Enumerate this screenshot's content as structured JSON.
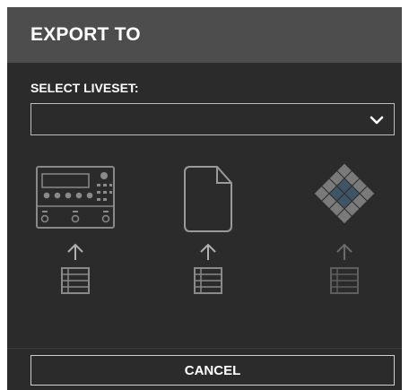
{
  "dialog": {
    "title": "EXPORT TO",
    "select_label": "SELECT LIVESET:",
    "liveset_select": {
      "value": ""
    },
    "targets": [
      {
        "icon": "hardware-unit-icon",
        "arrow_icon": "upload-arrow-icon",
        "list_icon": "setlist-icon",
        "enabled": true
      },
      {
        "icon": "file-icon",
        "arrow_icon": "upload-arrow-icon",
        "list_icon": "setlist-icon",
        "enabled": true
      },
      {
        "icon": "diamond-grid-icon",
        "arrow_icon": "upload-arrow-icon",
        "list_icon": "setlist-icon",
        "enabled": false
      }
    ],
    "cancel_label": "CANCEL"
  },
  "colors": {
    "header_bg": "#4d4d4d",
    "dialog_bg": "#2b2b2b",
    "icon_grey": "#8a8a8a",
    "icon_dim": "#6b6b6b",
    "grid_blue": "#3f5566"
  }
}
